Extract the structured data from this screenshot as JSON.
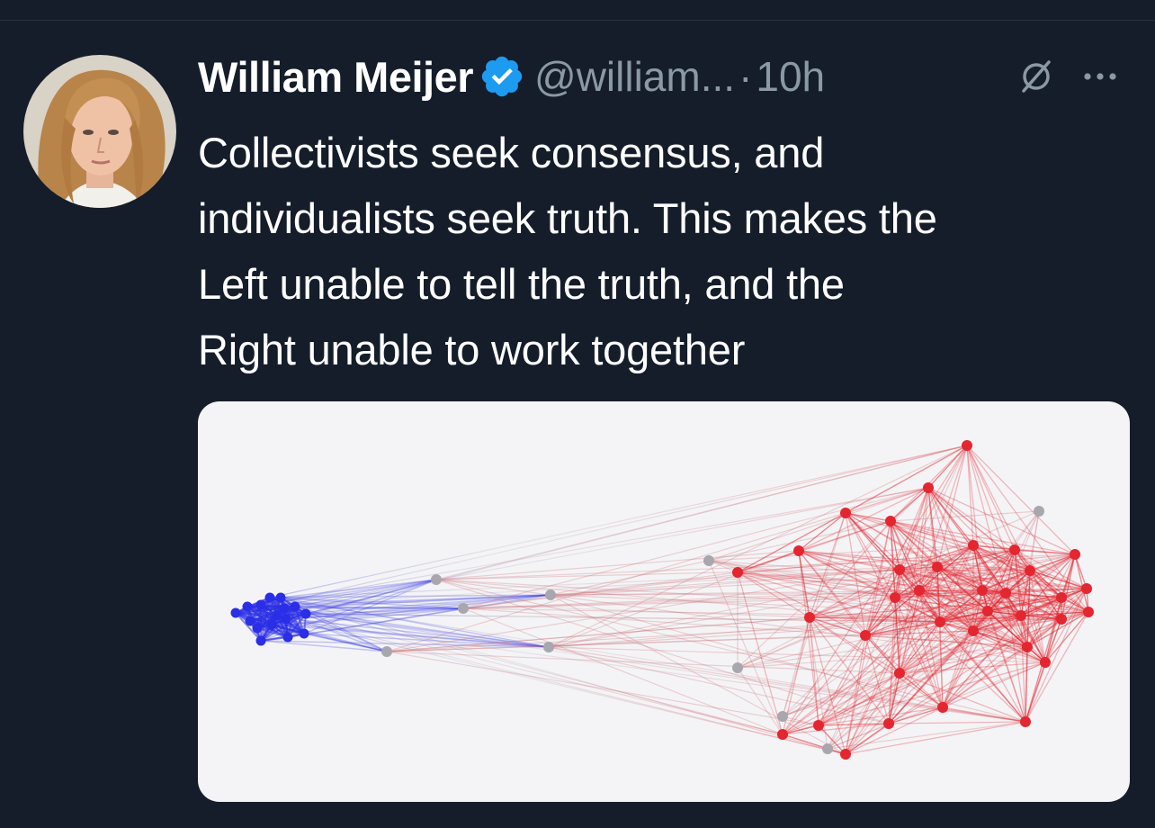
{
  "tweet": {
    "author": {
      "display_name": "William Meijer",
      "handle": "@william...",
      "verified": true,
      "avatar_icon": "avatar-photo"
    },
    "separator": "·",
    "timestamp": "10h",
    "text_lines": [
      "Collectivists seek consensus, and",
      "individualists seek truth. This makes the",
      "Left unable to tell the truth, and the",
      "Right unable to work together"
    ],
    "header_icons": [
      "grok-icon",
      "more-options-icon"
    ]
  },
  "colors": {
    "background": "#151d2a",
    "text_primary": "#ffffff",
    "text_secondary": "#8b98a5",
    "verified_blue": "#1d9bf0",
    "network_blue": "#2a2ee6",
    "network_red": "#e3262f",
    "network_gray": "#a7a7ad"
  }
}
